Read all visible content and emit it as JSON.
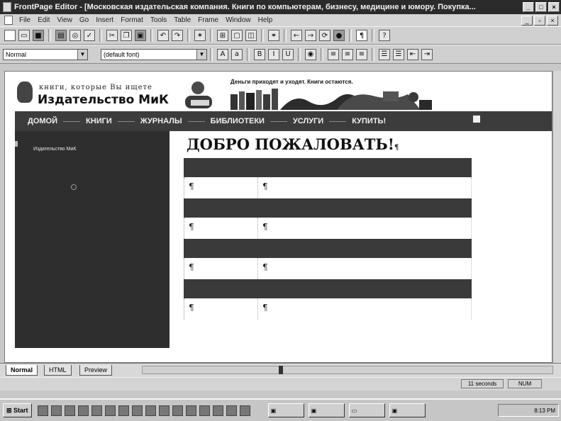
{
  "window": {
    "title": "FrontPage Editor - [Московская издательская компания. Книги по компьютерам, бизнесу, медицине и юмору. Покупка..."
  },
  "menu": [
    "File",
    "Edit",
    "View",
    "Go",
    "Insert",
    "Format",
    "Tools",
    "Table",
    "Frame",
    "Window",
    "Help"
  ],
  "format_toolbar": {
    "style_value": "Normal",
    "font_value": "(default font)"
  },
  "site": {
    "tagline": "книги, которые Вы ищете",
    "brand": "Издательство МиК",
    "quote": "Деньги приходят и уходят. Книги остаются.",
    "nav": [
      "ДОМОЙ",
      "КНИГИ",
      "ЖУРНАЛЫ",
      "БИБЛИОТЕКИ",
      "УСЛУГИ",
      "КУПИТЬ!"
    ],
    "sidebar_link": "Издательство МиК",
    "welcome": "ДОБРО ПОЖАЛОВАТЬ!",
    "pilcrow": "¶"
  },
  "view_tabs": [
    "Normal",
    "HTML",
    "Preview"
  ],
  "status": {
    "timing": "11 seconds",
    "num": "NUM"
  },
  "taskbar": {
    "start": "Start",
    "time": "8:13 PM"
  },
  "colors": {
    "nav_bg": "#3c3c3c",
    "sidebar_bg": "#2e2e2e",
    "table_header_bg": "#3a3a3a"
  }
}
